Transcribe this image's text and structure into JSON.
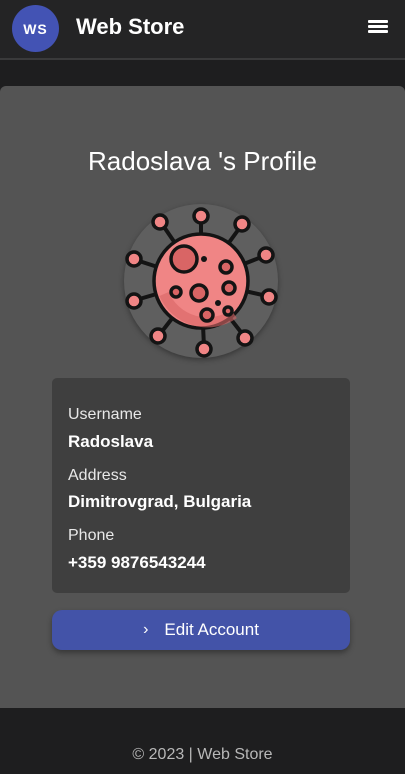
{
  "header": {
    "logo_text": "WS",
    "brand": "Web Store",
    "menu_icon": "hamburger-menu-icon",
    "bar_color": "#242425",
    "logo_color": "#4353b4"
  },
  "profile": {
    "title": "Radoslava 's Profile",
    "avatar_icon": "virus-icon",
    "fields": [
      {
        "label": "Username",
        "value": "Radoslava"
      },
      {
        "label": "Address",
        "value": "Dimitrovgrad, Bulgaria"
      },
      {
        "label": "Phone",
        "value": "+359 9876543244"
      }
    ],
    "edit_button_label": "Edit Account",
    "edit_button_icon": "chevron-right-icon",
    "accent_color": "#4353a8"
  },
  "footer": {
    "text": "© 2023 | Web Store"
  }
}
